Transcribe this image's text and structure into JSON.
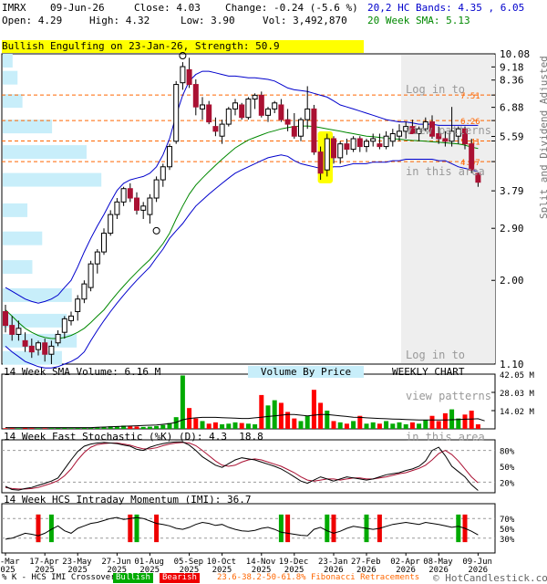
{
  "header": {
    "symbol": "IMRX",
    "date": "09-Jun-26",
    "close": "Close: 4.03",
    "change": "Change: -0.24 (-5.6 %)",
    "open": "Open: 4.29",
    "high": "High: 4.32",
    "low": "Low: 3.90",
    "vol": "Vol: 3,492,870",
    "bands": "20,2 HC Bands: 4.35 , 6.05",
    "sma": "20 Week SMA: 5.13"
  },
  "pattern_banner": "Bullish Engulfing on 23-Jan-26, Strength: 50.9",
  "login_note": {
    "top": [
      "Log in to",
      "view patterns",
      "in this area"
    ],
    "bottom": [
      "Log in to",
      "view patterns",
      "in this area"
    ]
  },
  "side_labels": {
    "adjusted": "Split and Dividend Adjusted",
    "scale": "Logarithmic"
  },
  "panel_titles": {
    "volume": "14 Week SMA Volume: 6.16 M",
    "vbp": "Volume By Price",
    "weekly": "WEEKLY CHART",
    "stoch": "14 Week Fast Stochastic (%K) (D): 4.3  18.8",
    "imi": "14 Week HCS Intraday Momentum (IMI): 36.7"
  },
  "footer": {
    "crossover": "% K - HCS IMI Crossover:",
    "bullish": "Bullish",
    "bearish": "Bearish",
    "fib": "23.6-38.2-50-61.8% Fibonacci Retracements",
    "brand": "© HotCandlestick.com"
  },
  "colors": {
    "up": "#ffffff",
    "down": "#aa1133",
    "upper_band": "#0000cc",
    "sma": "#008800",
    "volume_down": "#ff0000",
    "volume_up": "#00aa00",
    "vbp": "#c8eefa",
    "fib": "#ff6600",
    "highlight": "#ffff00",
    "login_shade": "#eeeeee"
  },
  "chart_data": [
    {
      "type": "candlestick",
      "scale": "log",
      "ylim": [
        1.1,
        10.08
      ],
      "price_ticks": [
        "10.08",
        "9.18",
        "8.36",
        "7.51",
        "6.88",
        "6.26",
        "5.59",
        "5.41",
        "4.67",
        "3.79",
        "2.90",
        "2.00",
        "1.10"
      ],
      "fib_levels": [
        7.51,
        6.26,
        5.41,
        4.67
      ],
      "x_labels": [
        "21-Mar 2025",
        "17-Apr 2025",
        "23-May 2025",
        "27-Jun 2025",
        "01-Aug 2025",
        "05-Sep 2025",
        "10-Oct 2025",
        "14-Nov 2025",
        "19-Dec 2025",
        "23-Jan 2026",
        "27-Feb 2026",
        "02-Apr 2026",
        "08-May 2026",
        "09-Jun 2026"
      ],
      "candles": [
        [
          1.6,
          1.68,
          1.38,
          1.45
        ],
        [
          1.45,
          1.55,
          1.3,
          1.36
        ],
        [
          1.36,
          1.5,
          1.3,
          1.42
        ],
        [
          1.3,
          1.38,
          1.2,
          1.25
        ],
        [
          1.25,
          1.32,
          1.15,
          1.2
        ],
        [
          1.22,
          1.3,
          1.17,
          1.28
        ],
        [
          1.28,
          1.32,
          1.12,
          1.18
        ],
        [
          1.18,
          1.3,
          1.1,
          1.25
        ],
        [
          1.28,
          1.4,
          1.25,
          1.36
        ],
        [
          1.38,
          1.55,
          1.32,
          1.52
        ],
        [
          1.5,
          1.6,
          1.45,
          1.55
        ],
        [
          1.6,
          1.8,
          1.5,
          1.75
        ],
        [
          1.75,
          2.0,
          1.7,
          1.95
        ],
        [
          1.9,
          2.3,
          1.85,
          2.25
        ],
        [
          2.25,
          2.5,
          2.1,
          2.45
        ],
        [
          2.45,
          2.9,
          2.4,
          2.8
        ],
        [
          2.8,
          3.3,
          2.75,
          3.2
        ],
        [
          3.2,
          3.6,
          3.1,
          3.5
        ],
        [
          3.5,
          3.9,
          3.4,
          3.85
        ],
        [
          3.85,
          4.0,
          3.5,
          3.6
        ],
        [
          3.6,
          3.75,
          3.2,
          3.3
        ],
        [
          3.3,
          3.5,
          3.1,
          3.4
        ],
        [
          3.2,
          3.7,
          3.0,
          3.6
        ],
        [
          3.6,
          4.2,
          3.5,
          4.1
        ],
        [
          4.1,
          4.6,
          3.9,
          4.5
        ],
        [
          4.5,
          5.3,
          4.4,
          5.2
        ],
        [
          5.4,
          8.3,
          5.3,
          8.1
        ],
        [
          8.2,
          9.5,
          7.8,
          9.2
        ],
        [
          9.0,
          9.8,
          7.9,
          8.1
        ],
        [
          8.1,
          8.4,
          6.5,
          6.9
        ],
        [
          6.8,
          7.4,
          6.3,
          7.0
        ],
        [
          7.0,
          7.2,
          6.1,
          6.2
        ],
        [
          6.0,
          6.4,
          5.6,
          5.8
        ],
        [
          5.6,
          6.3,
          5.3,
          6.1
        ],
        [
          6.1,
          6.9,
          6.0,
          6.8
        ],
        [
          6.8,
          7.3,
          6.5,
          7.1
        ],
        [
          7.0,
          7.1,
          6.3,
          6.4
        ],
        [
          6.4,
          7.4,
          6.3,
          7.3
        ],
        [
          7.3,
          7.6,
          6.8,
          7.5
        ],
        [
          7.5,
          7.7,
          6.4,
          6.5
        ],
        [
          6.5,
          6.9,
          6.2,
          6.8
        ],
        [
          6.8,
          7.2,
          6.6,
          7.1
        ],
        [
          7.0,
          7.3,
          6.2,
          6.3
        ],
        [
          6.3,
          6.8,
          5.8,
          6.1
        ],
        [
          6.0,
          6.6,
          5.5,
          5.6
        ],
        [
          5.6,
          6.4,
          5.4,
          6.3
        ],
        [
          6.3,
          8.0,
          5.9,
          6.8
        ],
        [
          6.8,
          7.0,
          4.9,
          5.0
        ],
        [
          5.0,
          5.2,
          4.1,
          4.3
        ],
        [
          4.4,
          5.7,
          4.2,
          5.5
        ],
        [
          5.5,
          5.6,
          4.6,
          4.8
        ],
        [
          4.8,
          5.4,
          4.6,
          5.3
        ],
        [
          5.3,
          5.5,
          4.9,
          5.1
        ],
        [
          5.1,
          5.6,
          5.0,
          5.5
        ],
        [
          5.5,
          5.6,
          5.0,
          5.2
        ],
        [
          5.2,
          5.5,
          5.0,
          5.4
        ],
        [
          5.4,
          5.7,
          5.2,
          5.5
        ],
        [
          5.3,
          5.7,
          5.1,
          5.2
        ],
        [
          5.2,
          5.8,
          5.1,
          5.6
        ],
        [
          5.4,
          5.9,
          5.2,
          5.7
        ],
        [
          5.6,
          6.1,
          5.4,
          5.8
        ],
        [
          5.8,
          6.2,
          5.5,
          6.0
        ],
        [
          6.0,
          6.3,
          5.7,
          5.7
        ],
        [
          5.7,
          6.0,
          5.4,
          5.9
        ],
        [
          5.9,
          6.4,
          5.8,
          6.2
        ],
        [
          6.2,
          6.5,
          5.5,
          5.6
        ],
        [
          5.7,
          6.0,
          5.3,
          5.5
        ],
        [
          5.5,
          5.8,
          5.2,
          5.4
        ],
        [
          5.4,
          6.9,
          5.2,
          5.8
        ],
        [
          5.6,
          6.0,
          5.3,
          5.9
        ],
        [
          5.9,
          6.0,
          5.1,
          5.3
        ],
        [
          5.3,
          5.5,
          4.3,
          4.4
        ],
        [
          4.29,
          4.32,
          3.9,
          4.03
        ]
      ],
      "upper_band": [
        1.9,
        1.85,
        1.8,
        1.75,
        1.72,
        1.7,
        1.72,
        1.75,
        1.8,
        1.9,
        2.0,
        2.2,
        2.45,
        2.7,
        2.95,
        3.2,
        3.5,
        3.8,
        4.0,
        4.1,
        4.15,
        4.2,
        4.3,
        4.5,
        4.9,
        5.5,
        6.5,
        7.5,
        8.3,
        8.7,
        8.9,
        8.9,
        8.8,
        8.7,
        8.6,
        8.6,
        8.55,
        8.5,
        8.5,
        8.45,
        8.4,
        8.3,
        8.1,
        7.9,
        7.8,
        7.75,
        7.7,
        7.6,
        7.5,
        7.4,
        7.2,
        7.0,
        6.9,
        6.8,
        6.7,
        6.6,
        6.5,
        6.4,
        6.3,
        6.25,
        6.2,
        6.2,
        6.15,
        6.1,
        6.1,
        6.1,
        6.05,
        6.05,
        6.05,
        6.05,
        6.05,
        6.05,
        6.05
      ],
      "lower_band": [
        1.25,
        1.2,
        1.16,
        1.12,
        1.1,
        1.08,
        1.07,
        1.07,
        1.08,
        1.1,
        1.12,
        1.15,
        1.2,
        1.3,
        1.4,
        1.5,
        1.6,
        1.7,
        1.8,
        1.9,
        2.0,
        2.1,
        2.2,
        2.35,
        2.5,
        2.7,
        2.85,
        3.0,
        3.2,
        3.4,
        3.55,
        3.7,
        3.85,
        4.0,
        4.15,
        4.3,
        4.4,
        4.5,
        4.6,
        4.7,
        4.8,
        4.85,
        4.9,
        4.85,
        4.7,
        4.6,
        4.55,
        4.5,
        4.45,
        4.45,
        4.5,
        4.5,
        4.55,
        4.6,
        4.6,
        4.6,
        4.65,
        4.65,
        4.65,
        4.7,
        4.7,
        4.75,
        4.75,
        4.75,
        4.75,
        4.75,
        4.7,
        4.7,
        4.6,
        4.5,
        4.45,
        4.4,
        4.35
      ],
      "sma": [
        1.62,
        1.55,
        1.48,
        1.42,
        1.38,
        1.35,
        1.33,
        1.32,
        1.32,
        1.33,
        1.35,
        1.38,
        1.42,
        1.48,
        1.55,
        1.62,
        1.72,
        1.82,
        1.92,
        2.02,
        2.12,
        2.22,
        2.32,
        2.45,
        2.6,
        2.8,
        3.1,
        3.4,
        3.7,
        3.95,
        4.15,
        4.35,
        4.55,
        4.75,
        4.95,
        5.15,
        5.3,
        5.45,
        5.55,
        5.65,
        5.75,
        5.82,
        5.9,
        5.95,
        6.0,
        6.02,
        6.02,
        6.0,
        5.95,
        5.9,
        5.85,
        5.8,
        5.75,
        5.7,
        5.65,
        5.6,
        5.58,
        5.55,
        5.52,
        5.5,
        5.48,
        5.45,
        5.43,
        5.42,
        5.4,
        5.38,
        5.36,
        5.34,
        5.32,
        5.3,
        5.25,
        5.18,
        5.13
      ],
      "volume_by_price": [
        [
          1.15,
          0.12
        ],
        [
          1.3,
          0.15
        ],
        [
          1.5,
          0.13
        ],
        [
          1.8,
          0.14
        ],
        [
          2.2,
          0.06
        ],
        [
          2.7,
          0.08
        ],
        [
          3.3,
          0.05
        ],
        [
          4.1,
          0.2
        ],
        [
          5.0,
          0.17
        ],
        [
          6.0,
          0.1
        ],
        [
          7.2,
          0.04
        ],
        [
          8.5,
          0.03
        ],
        [
          9.6,
          0.02
        ]
      ]
    },
    {
      "type": "bar",
      "name": "volume",
      "y_ticks": [
        "42.05 M",
        "28.03 M",
        "14.02 M"
      ],
      "ylim": [
        0,
        42.05
      ],
      "values": [
        0.5,
        0.6,
        0.5,
        0.7,
        0.6,
        0.5,
        0.5,
        0.6,
        0.7,
        0.8,
        0.6,
        0.7,
        0.9,
        1.0,
        1.2,
        1.5,
        2.0,
        1.8,
        2.5,
        2.0,
        1.8,
        1.5,
        1.7,
        2.2,
        3.0,
        4.5,
        9.0,
        41.0,
        16.0,
        8.0,
        6.0,
        4.0,
        5.0,
        3.5,
        4.0,
        5.0,
        4.5,
        4.0,
        3.5,
        26.0,
        18.0,
        22.0,
        20.0,
        13.0,
        8.0,
        6.0,
        10.0,
        30.0,
        20.0,
        14.0,
        6.0,
        5.0,
        4.0,
        6.0,
        10.0,
        4.0,
        5.0,
        4.0,
        6.0,
        4.0,
        5.0,
        3.5,
        5.0,
        4.0,
        7.0,
        10.0,
        6.0,
        12.0,
        15.0,
        8.0,
        11.0,
        14.0,
        3.5
      ],
      "sma": [
        1,
        1,
        1,
        1,
        1,
        1,
        1,
        1,
        1,
        1,
        1,
        1,
        1,
        1,
        1.2,
        1.4,
        1.6,
        1.8,
        2,
        2.2,
        2.4,
        2.6,
        2.8,
        3,
        3.5,
        4,
        5,
        7,
        8,
        8.5,
        8.8,
        8.8,
        8.8,
        8.6,
        8.4,
        8.2,
        8,
        8,
        8.5,
        9,
        9.5,
        10,
        10.5,
        11,
        11,
        10.5,
        10,
        10.5,
        11,
        11,
        10.5,
        10,
        9.5,
        9,
        8.8,
        8.5,
        8.2,
        8,
        7.8,
        7.6,
        7.4,
        7.2,
        7,
        6.9,
        6.8,
        6.8,
        6.8,
        6.9,
        7,
        7.2,
        7.4,
        7.6,
        7.8,
        6.16
      ]
    },
    {
      "type": "line",
      "name": "stochastic",
      "y_ticks": [
        "80%",
        "50%",
        "20%"
      ],
      "ylim": [
        0,
        100
      ],
      "k": [
        12,
        6,
        5,
        8,
        10,
        14,
        18,
        22,
        28,
        45,
        62,
        78,
        88,
        92,
        94,
        95,
        94,
        93,
        90,
        88,
        82,
        80,
        86,
        90,
        93,
        95,
        96,
        96,
        90,
        80,
        68,
        60,
        52,
        48,
        55,
        62,
        66,
        64,
        62,
        58,
        54,
        50,
        45,
        38,
        30,
        22,
        18,
        24,
        30,
        26,
        22,
        26,
        30,
        28,
        26,
        24,
        26,
        30,
        34,
        36,
        38,
        42,
        45,
        50,
        60,
        80,
        86,
        70,
        50,
        40,
        30,
        15,
        4.3
      ],
      "d": [
        10,
        8,
        7,
        7,
        8,
        10,
        14,
        18,
        23,
        32,
        45,
        62,
        76,
        86,
        91,
        93,
        94,
        94,
        92,
        90,
        86,
        83,
        83,
        85,
        89,
        92,
        94,
        95,
        94,
        89,
        80,
        70,
        60,
        52,
        50,
        52,
        58,
        62,
        64,
        62,
        58,
        54,
        50,
        44,
        38,
        30,
        24,
        22,
        24,
        26,
        26,
        24,
        26,
        28,
        28,
        26,
        26,
        28,
        30,
        33,
        36,
        38,
        42,
        46,
        52,
        62,
        74,
        80,
        72,
        60,
        45,
        30,
        18.8
      ]
    },
    {
      "type": "line",
      "name": "imi",
      "y_ticks": [
        "70%",
        "50%",
        "30%"
      ],
      "ylim": [
        0,
        100
      ],
      "values": [
        28,
        30,
        35,
        40,
        38,
        35,
        40,
        48,
        55,
        45,
        40,
        50,
        55,
        60,
        62,
        66,
        70,
        72,
        68,
        70,
        72,
        70,
        65,
        60,
        58,
        55,
        50,
        48,
        52,
        58,
        62,
        60,
        56,
        58,
        52,
        48,
        45,
        44,
        46,
        50,
        52,
        48,
        42,
        40,
        38,
        36,
        35,
        48,
        52,
        45,
        40,
        44,
        50,
        54,
        52,
        50,
        48,
        50,
        54,
        58,
        60,
        62,
        60,
        58,
        62,
        60,
        58,
        55,
        52,
        54,
        50,
        44,
        36.7
      ],
      "crossovers": [
        {
          "i": 11,
          "kind": "bullish"
        },
        {
          "i": 12,
          "kind": "bearish"
        },
        {
          "i": 15,
          "kind": "bullish"
        },
        {
          "i": 42,
          "kind": "bearish"
        },
        {
          "i": 45,
          "kind": "bullish"
        },
        {
          "i": 51,
          "kind": "bearish"
        },
        {
          "i": 92,
          "kind": "bullish"
        },
        {
          "i": 95,
          "kind": "bearish"
        },
        {
          "i": 108,
          "kind": "bullish"
        },
        {
          "i": 110,
          "kind": "bearish"
        },
        {
          "i": 120,
          "kind": "bullish"
        },
        {
          "i": 125,
          "kind": "bearish"
        },
        {
          "i": 151,
          "kind": "bullish"
        },
        {
          "i": 155,
          "kind": "bearish"
        }
      ]
    }
  ]
}
